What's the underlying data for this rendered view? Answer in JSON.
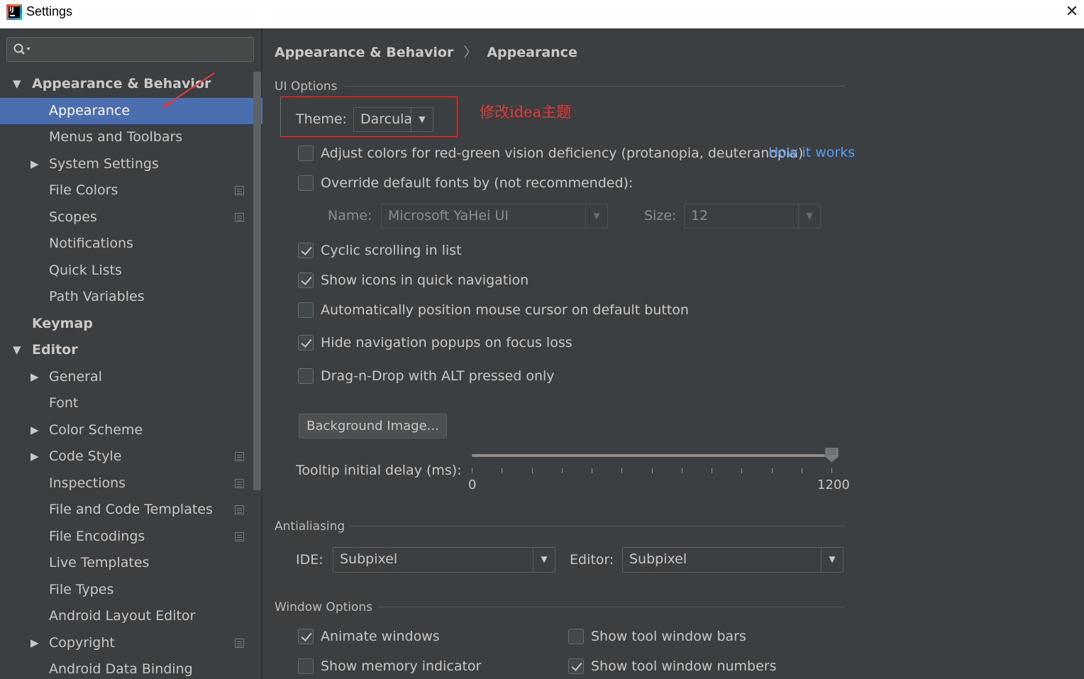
{
  "window": {
    "title": "Settings",
    "app_icon": "intellij-idea-icon",
    "close_icon": "close-icon"
  },
  "search": {
    "placeholder": "",
    "icon": "search-icon"
  },
  "sidebar": {
    "items": [
      {
        "label": "Appearance & Behavior",
        "level": 0,
        "expanded": true,
        "bold": true
      },
      {
        "label": "Appearance",
        "level": 1,
        "selected": true
      },
      {
        "label": "Menus and Toolbars",
        "level": 1
      },
      {
        "label": "System Settings",
        "level": 1,
        "collapsed": true
      },
      {
        "label": "File Colors",
        "level": 1,
        "project": true
      },
      {
        "label": "Scopes",
        "level": 1,
        "project": true
      },
      {
        "label": "Notifications",
        "level": 1
      },
      {
        "label": "Quick Lists",
        "level": 1
      },
      {
        "label": "Path Variables",
        "level": 1
      },
      {
        "label": "Keymap",
        "level": 0,
        "bold": true
      },
      {
        "label": "Editor",
        "level": 0,
        "expanded": true,
        "bold": true
      },
      {
        "label": "General",
        "level": 1,
        "collapsed": true
      },
      {
        "label": "Font",
        "level": 1
      },
      {
        "label": "Color Scheme",
        "level": 1,
        "collapsed": true
      },
      {
        "label": "Code Style",
        "level": 1,
        "collapsed": true,
        "project": true
      },
      {
        "label": "Inspections",
        "level": 1,
        "project": true
      },
      {
        "label": "File and Code Templates",
        "level": 1,
        "project": true
      },
      {
        "label": "File Encodings",
        "level": 1,
        "project": true
      },
      {
        "label": "Live Templates",
        "level": 1
      },
      {
        "label": "File Types",
        "level": 1
      },
      {
        "label": "Android Layout Editor",
        "level": 1
      },
      {
        "label": "Copyright",
        "level": 1,
        "collapsed": true,
        "project": true
      },
      {
        "label": "Android Data Binding",
        "level": 1
      }
    ]
  },
  "breadcrumb": {
    "parent": "Appearance & Behavior",
    "separator": "〉",
    "current": "Appearance"
  },
  "ui_options": {
    "section": "UI Options",
    "theme_label": "Theme:",
    "theme_value": "Darcula",
    "annotation": "修改idea主题",
    "adjust_colors": {
      "label": "Adjust colors for red-green vision deficiency (protanopia, deuteranopia)",
      "checked": false,
      "link": "How it works"
    },
    "override_fonts": {
      "label": "Override default fonts by (not recommended):",
      "checked": false
    },
    "font_name_label": "Name:",
    "font_name_value": "Microsoft YaHei UI",
    "font_size_label": "Size:",
    "font_size_value": "12",
    "cyclic_scrolling": {
      "label": "Cyclic scrolling in list",
      "checked": true
    },
    "show_icons": {
      "label": "Show icons in quick navigation",
      "checked": true
    },
    "auto_position": {
      "label": "Automatically position mouse cursor on default button",
      "checked": false
    },
    "hide_popups": {
      "label": "Hide navigation popups on focus loss",
      "checked": true
    },
    "drag_drop": {
      "label": "Drag-n-Drop with ALT pressed only",
      "checked": false
    },
    "background_button": "Background Image...",
    "tooltip_label": "Tooltip initial delay (ms):",
    "tooltip_min": "0",
    "tooltip_max": "1200",
    "tooltip_value_fraction": 1.0
  },
  "antialiasing": {
    "section": "Antialiasing",
    "ide_label": "IDE:",
    "ide_value": "Subpixel",
    "editor_label": "Editor:",
    "editor_value": "Subpixel"
  },
  "window_options": {
    "section": "Window Options",
    "animate_windows": {
      "label": "Animate windows",
      "checked": true
    },
    "show_memory": {
      "label": "Show memory indicator",
      "checked": false
    },
    "show_tool_bars": {
      "label": "Show tool window bars",
      "checked": false
    },
    "show_tool_numbers": {
      "label": "Show tool window numbers",
      "checked": true
    }
  },
  "colors": {
    "selection": "#4b6eaf",
    "background": "#3c3f41",
    "link": "#589df6",
    "annotation": "#e53935"
  }
}
